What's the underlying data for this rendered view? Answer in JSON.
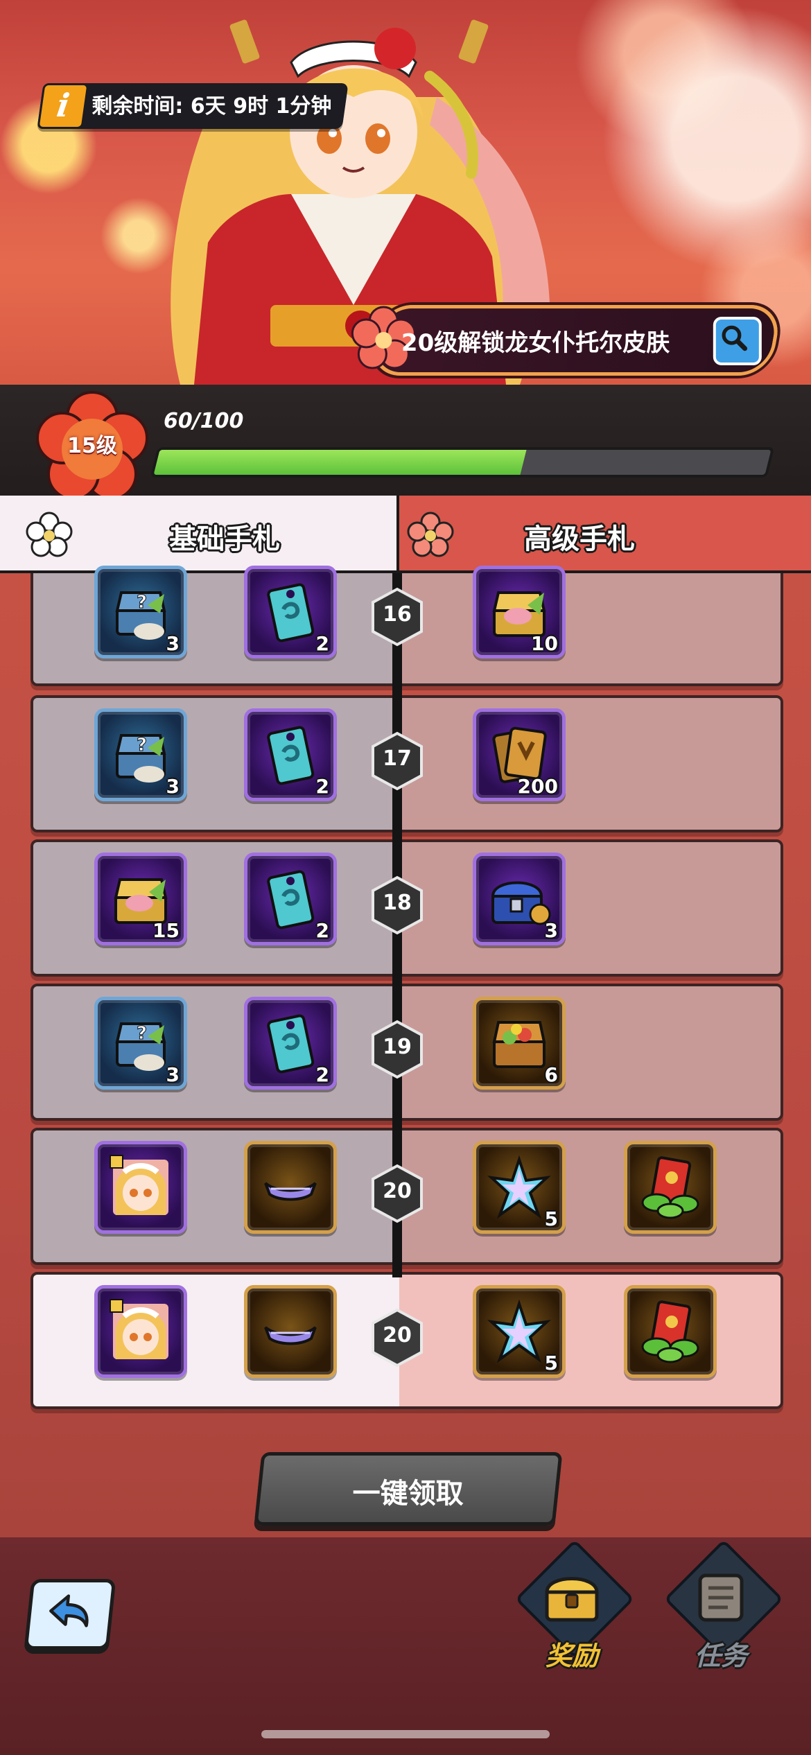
{
  "event": {
    "timer_label": "剩余时间:",
    "timer_value": "6天 9时 1分钟",
    "skin_unlock_text": "20级解锁龙女仆托尔皮肤"
  },
  "level": {
    "level_label": "15级",
    "xp_text": "60/100",
    "xp_fraction": 0.6
  },
  "tabs": {
    "basic_label": "基础手札",
    "advanced_label": "高级手札"
  },
  "tiers": [
    {
      "level": "16",
      "basic": [
        {
          "icon": "mystery-chest-icon",
          "qty": "3"
        },
        {
          "icon": "ticket-icon",
          "qty": "2"
        }
      ],
      "advanced": [
        {
          "icon": "gold-chest-icon",
          "qty": "10"
        }
      ]
    },
    {
      "level": "17",
      "basic": [
        {
          "icon": "mystery-chest-icon",
          "qty": "3"
        },
        {
          "icon": "ticket-icon",
          "qty": "2"
        }
      ],
      "advanced": [
        {
          "icon": "cards-icon",
          "qty": "200"
        }
      ]
    },
    {
      "level": "18",
      "basic": [
        {
          "icon": "gold-chest-icon",
          "qty": "15"
        },
        {
          "icon": "ticket-icon",
          "qty": "2"
        }
      ],
      "advanced": [
        {
          "icon": "blue-chest-icon",
          "qty": "3"
        }
      ]
    },
    {
      "level": "19",
      "basic": [
        {
          "icon": "mystery-chest-icon",
          "qty": "3"
        },
        {
          "icon": "ticket-icon",
          "qty": "2"
        }
      ],
      "advanced": [
        {
          "icon": "treasure-chest-icon",
          "qty": "6"
        }
      ]
    },
    {
      "level": "20",
      "basic": [
        {
          "icon": "character-skin-icon",
          "qty": ""
        },
        {
          "icon": "headband-icon",
          "qty": ""
        }
      ],
      "advanced": [
        {
          "icon": "crystal-star-icon",
          "qty": "5"
        },
        {
          "icon": "red-envelope-icon",
          "qty": ""
        }
      ]
    },
    {
      "level": "20",
      "basic": [
        {
          "icon": "character-skin-icon",
          "qty": ""
        },
        {
          "icon": "headband-icon",
          "qty": ""
        }
      ],
      "advanced": [
        {
          "icon": "crystal-star-icon",
          "qty": "5"
        },
        {
          "icon": "red-envelope-icon",
          "qty": ""
        }
      ]
    }
  ],
  "actions": {
    "claim_all_label": "一键领取"
  },
  "nav": {
    "rewards_label": "奖励",
    "tasks_label": "任务"
  },
  "colors": {
    "xp_green": "#7cd84a",
    "advanced_tab": "#d8564b",
    "rewards_label": "#f3c233",
    "tasks_label": "#8a9099"
  }
}
